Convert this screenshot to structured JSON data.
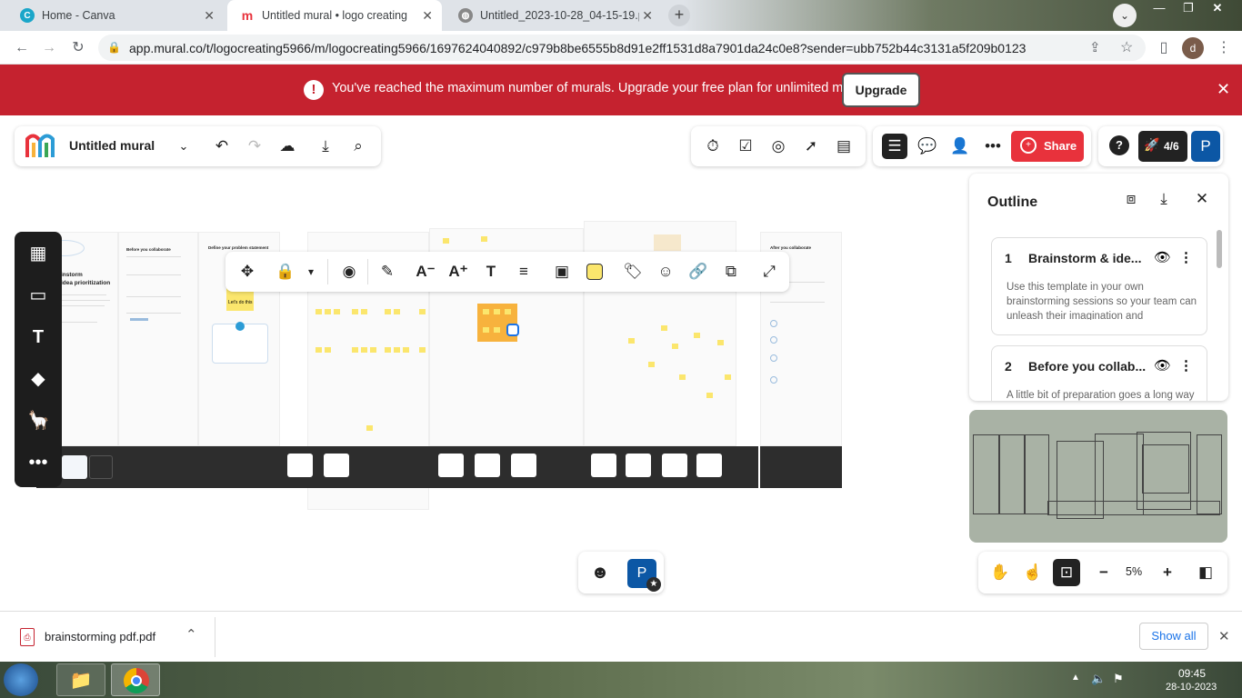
{
  "browser": {
    "tabs": [
      {
        "title": "Home - Canva",
        "active": false
      },
      {
        "title": "Untitled mural • logo creating",
        "active": true
      },
      {
        "title": "Untitled_2023-10-28_04-15-19.p",
        "active": false
      }
    ],
    "url": "app.mural.co/t/logocreating5966/m/logocreating5966/1697624040892/c979b8be6555b8d91e2ff1531d8a7901da24c0e8?sender=ubb752b44c3131a5f209b0123",
    "profile_initial": "d"
  },
  "banner": {
    "message": "You've reached the maximum number of murals. Upgrade your free plan for unlimited murals.",
    "button": "Upgrade"
  },
  "toolbar": {
    "mural_title": "Untitled mural",
    "share_label": "Share",
    "progress_label": "4/6",
    "user_initial": "P"
  },
  "outline": {
    "title": "Outline",
    "items": [
      {
        "number": "1",
        "title": "Brainstorm  & ide...",
        "description": "Use this template in your own brainstorming sessions so your team can unleash their imagination and"
      },
      {
        "number": "2",
        "title": "Before you collab...",
        "description": "A little bit of preparation goes a long way"
      }
    ]
  },
  "canvas": {
    "frame1_heading": "instorm\nidea prioritization",
    "frame2_heading": "Before you collaborate",
    "frame3_heading": "Define your problem statement",
    "frame6_heading": "After you collaborate",
    "sticky_text": "Let's do this"
  },
  "zoom": {
    "level": "5%"
  },
  "bottom_user": {
    "initial": "P"
  },
  "download": {
    "filename": "brainstorming pdf.pdf",
    "show_all": "Show all"
  },
  "taskbar": {
    "time": "09:45",
    "date": "28-10-2023"
  },
  "colors": {
    "banner": "#c5222f",
    "share": "#e8323c",
    "user": "#0c57a5",
    "sticky": "#fbe66d"
  }
}
